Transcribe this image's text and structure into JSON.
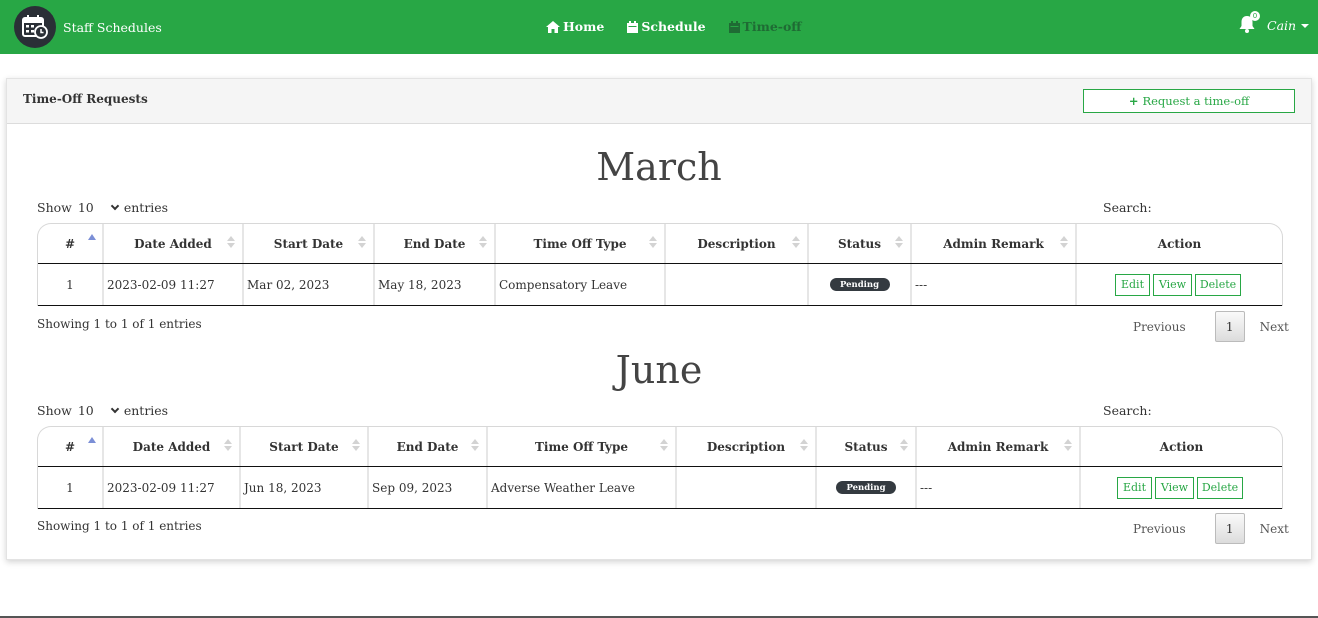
{
  "navbar": {
    "brand": "Staff Schedules",
    "links": [
      {
        "label": "Home",
        "icon": "home-icon"
      },
      {
        "label": "Schedule",
        "icon": "calendar-icon"
      },
      {
        "label": "Time-off",
        "icon": "calendar-x-icon"
      }
    ],
    "notification_count": "0",
    "user": "Cain",
    "accent_color": "#28a745"
  },
  "card": {
    "title": "Time-Off Requests",
    "request_button": "Request a time-off"
  },
  "table_labels": {
    "show": "Show",
    "entries": "entries",
    "search": "Search:",
    "previous": "Previous",
    "next": "Next"
  },
  "columns": [
    "#",
    "Date Added",
    "Start Date",
    "End Date",
    "Time Off Type",
    "Description",
    "Status",
    "Admin Remark",
    "Action"
  ],
  "sections": [
    {
      "month": "March",
      "page_length": "10",
      "rows": [
        {
          "num": "1",
          "date_added": "2023-02-09 11:27",
          "start": "Mar 02, 2023",
          "end": "May 18, 2023",
          "type": "Compensatory Leave",
          "description": "",
          "status": "Pending",
          "remark": "---"
        }
      ],
      "info": "Showing 1 to 1 of 1 entries",
      "page": "1"
    },
    {
      "month": "June",
      "page_length": "10",
      "rows": [
        {
          "num": "1",
          "date_added": "2023-02-09 11:27",
          "start": "Jun 18, 2023",
          "end": "Sep 09, 2023",
          "type": "Adverse Weather Leave",
          "description": "",
          "status": "Pending",
          "remark": "---"
        }
      ],
      "info": "Showing 1 to 1 of 1 entries",
      "page": "1"
    }
  ],
  "actions": {
    "edit": "Edit",
    "view": "View",
    "delete": "Delete"
  }
}
